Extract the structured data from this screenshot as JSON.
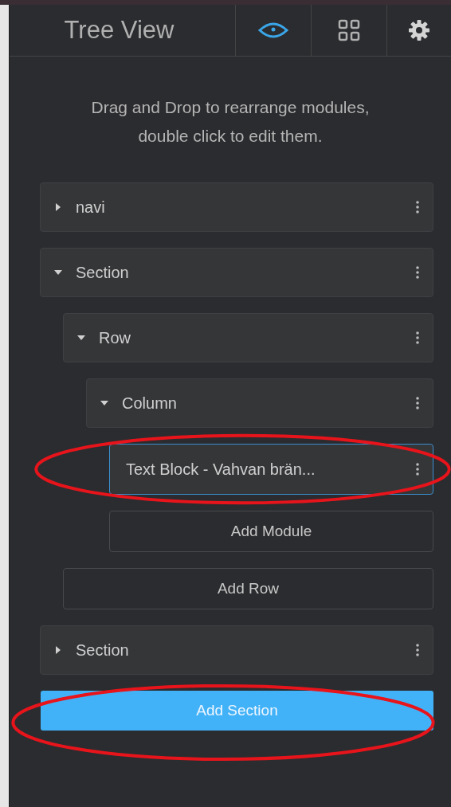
{
  "header": {
    "title": "Tree View",
    "tabs": [
      {
        "kind": "eye",
        "selected": true
      },
      {
        "kind": "grid",
        "selected": false
      },
      {
        "kind": "gear",
        "selected": false
      }
    ]
  },
  "description": "Drag and Drop to rearrange modules,\ndouble click to edit them.",
  "tree": [
    {
      "label": "navi",
      "kind": "container",
      "expanded": false,
      "selected": false,
      "circled": false
    },
    {
      "label": "Section",
      "kind": "container",
      "expanded": true,
      "selected": false,
      "circled": false,
      "add_button": "Add Row",
      "children": [
        {
          "label": "Row",
          "kind": "container",
          "expanded": true,
          "selected": false,
          "circled": false,
          "children": [
            {
              "label": "Column",
              "kind": "container",
              "expanded": true,
              "selected": false,
              "circled": false,
              "add_button": "Add Module",
              "children": [
                {
                  "label": "Text Block - Vahvan brän...",
                  "kind": "module",
                  "selected": true,
                  "circled": true
                }
              ]
            }
          ]
        }
      ]
    },
    {
      "label": "Section",
      "kind": "container",
      "expanded": false,
      "selected": false,
      "circled": false
    }
  ],
  "primary_button": {
    "label": "Add Section",
    "circled": true
  }
}
